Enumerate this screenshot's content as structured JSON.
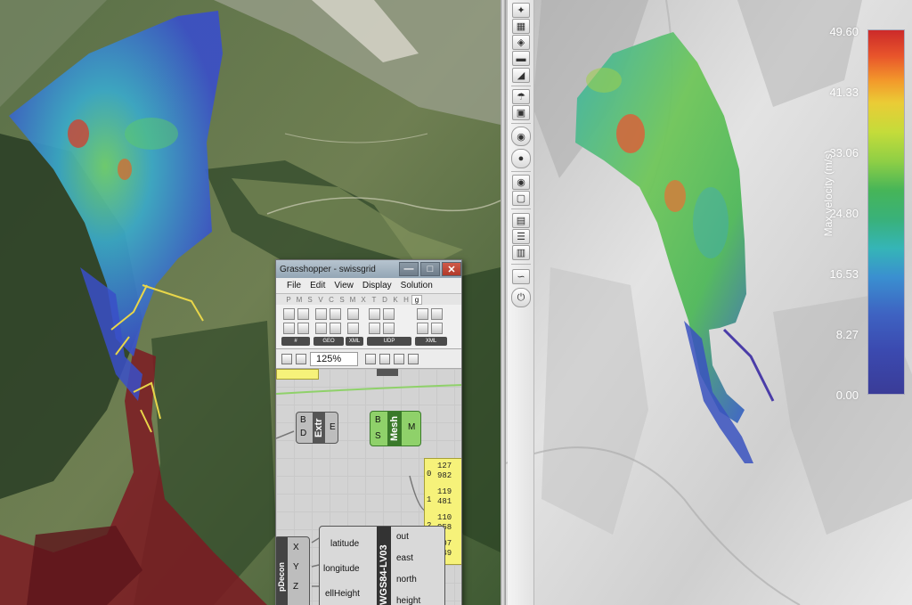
{
  "colors": {
    "accent": "#3a6fd0",
    "flow_red": "#9b1f26",
    "toolbar_bg": "#e9e9e9"
  },
  "toolbar": {
    "buttons": [
      {
        "icon": "bulb-icon"
      },
      {
        "icon": "grid-icon"
      },
      {
        "icon": "layers-icon"
      },
      {
        "icon": "rainbow-icon"
      },
      {
        "icon": "slope-icon"
      },
      {
        "icon": "umbrella-icon"
      },
      {
        "icon": "camera-red-icon"
      },
      {
        "icon": "globe-icon"
      },
      {
        "icon": "target-icon"
      },
      {
        "icon": "eye-icon"
      },
      {
        "icon": "camera-icon"
      },
      {
        "icon": "document-icon"
      },
      {
        "icon": "list-icon"
      },
      {
        "icon": "export-icon"
      },
      {
        "icon": "wave-icon"
      },
      {
        "icon": "power-icon"
      }
    ]
  },
  "colorbar": {
    "title": "Max velocity (m/s)",
    "ticks": [
      "49.60",
      "41.33",
      "33.06",
      "24.80",
      "16.53",
      "8.27",
      "0.00"
    ]
  },
  "grasshopper": {
    "title": "Grasshopper - swissgrid",
    "menu": [
      "File",
      "Edit",
      "View",
      "Display",
      "Solution"
    ],
    "tabs": [
      "P",
      "M",
      "S",
      "V",
      "C",
      "S",
      "M",
      "X",
      "T",
      "D",
      "K",
      "H",
      "g"
    ],
    "ribbon_groups": [
      "#",
      "GEO",
      "XML",
      "UDP",
      "XML"
    ],
    "zoom": "125%",
    "nodes": {
      "extr": {
        "name": "Extr",
        "inputs": [
          "B",
          "D"
        ],
        "outputs": [
          "E"
        ]
      },
      "mesh": {
        "name": "Mesh",
        "inputs": [
          "B",
          "S"
        ],
        "outputs": [
          "M"
        ]
      },
      "converter": {
        "name": "WGS84-LV03",
        "inputs": [
          "latitude",
          "longitude",
          "ellHeight"
        ],
        "outputs": [
          "out",
          "east",
          "north",
          "height"
        ]
      },
      "deconstruct": {
        "name": "pDecon",
        "outputs": [
          "X",
          "Y",
          "Z"
        ]
      }
    },
    "panel": {
      "rows": [
        {
          "index": "0",
          "values": [
            "127",
            "982"
          ]
        },
        {
          "index": "1",
          "values": [
            "119",
            "481"
          ]
        },
        {
          "index": "2",
          "values": [
            "110",
            "958"
          ]
        },
        {
          "index": "3",
          "values": [
            "107",
            "749"
          ]
        }
      ]
    }
  }
}
